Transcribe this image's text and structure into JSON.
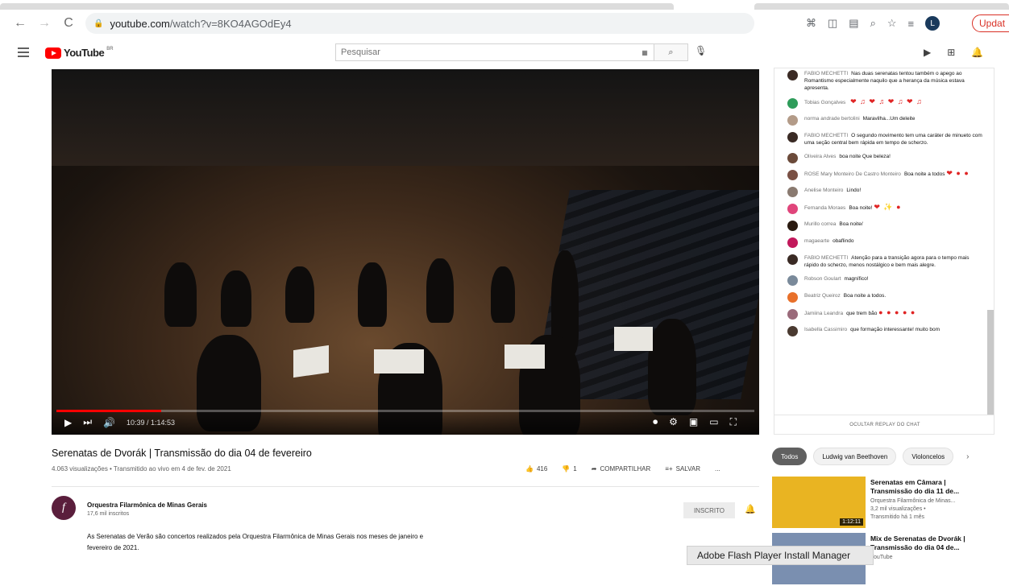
{
  "browser": {
    "url_host": "youtube.com",
    "url_path": "/watch?v=8KO4AGOdEy4",
    "profile_initial": "L",
    "update_label": "Updat"
  },
  "header": {
    "logo_text": "YouTube",
    "logo_suffix": "BR",
    "search_placeholder": "Pesquisar"
  },
  "player": {
    "time": "10:39 / 1:14:53",
    "progress": 0.15
  },
  "video": {
    "title": "Serenatas de Dvorák | Transmissão do dia 04 de fevereiro",
    "meta": "4.063 visualizações • Transmitido ao vivo em 4 de fev. de 2021",
    "likes": "416",
    "dislikes": "1",
    "share_label": "COMPARTILHAR",
    "save_label": "SALVAR",
    "more_label": "..."
  },
  "channel": {
    "name": "Orquestra Filarmônica de Minas Gerais",
    "subs": "17,6 mil inscritos",
    "subscribe_label": "INSCRITO",
    "avatar_letter": "f",
    "description": "As Serenatas de Verão são concertos realizados pela Orquestra Filarmônica de Minas Gerais nos meses de janeiro e fevereiro de 2021."
  },
  "chat": {
    "messages": [
      {
        "author": "FABIO MECHETTI",
        "text": "Nas duas serenatas tentou também o apego ao Romantismo especialmente naquilo que a herança da música estava apresenta.",
        "color": "#3a2a24"
      },
      {
        "author": "Tobias Gonçalves",
        "text": "",
        "emoji": "❤ ♫ ❤ ♫ ❤ ♫ ❤ ♫",
        "color": "#2e9c5a"
      },
      {
        "author": "norma andrade bertolini",
        "text": "Maravilha...Um deleite",
        "color": "#b39b88"
      },
      {
        "author": "FABIO MECHETTI",
        "text": "O segundo movimento tem uma caráter de minueto com uma seção central bem rápida em tempo de scherzo.",
        "color": "#3a2a24"
      },
      {
        "author": "Oliveira Alves",
        "text": "boa noite Que beleza!",
        "color": "#6b4a3a"
      },
      {
        "author": "ROSE Mary Monteiro De Castro Monteiro",
        "text": "Boa noite a todos",
        "emoji": "❤ ● ●",
        "color": "#7a5044"
      },
      {
        "author": "Anelise Monteiro",
        "text": "Lindo!",
        "color": "#8a7a70"
      },
      {
        "author": "Fernanda Moraes",
        "text": "Boa noite!",
        "emoji": "❤ ✨ ●",
        "color": "#e0457b"
      },
      {
        "author": "Murillo correa",
        "text": "Boa noite/",
        "color": "#2a1a10"
      },
      {
        "author": "magaearte",
        "text": "obaflindo",
        "color": "#c2185b"
      },
      {
        "author": "FABIO MECHETTI",
        "text": "Atenção para a transição agora para o tempo mais rápido do scherzo, menos nostálgico e bem mais alegre.",
        "color": "#3a2a24"
      },
      {
        "author": "Robson Goulart",
        "text": "magnífico!",
        "color": "#7a8a9a"
      },
      {
        "author": "Beatriz Queiroz",
        "text": "Boa noite a todos.",
        "color": "#e8702a"
      },
      {
        "author": "Jamiina Leandra",
        "text": "que trem bão",
        "emoji": "● ● ● ● ●",
        "color": "#9a6a7a"
      },
      {
        "author": "Isabella Cassimiro",
        "text": "que formação interessante! muito bom",
        "color": "#4a3a30"
      }
    ],
    "footer": "OCULTAR REPLAY DO CHAT"
  },
  "chips": {
    "items": [
      "Todos",
      "Ludwig van Beethoven",
      "Violoncelos"
    ],
    "next": "›"
  },
  "related": [
    {
      "title": "Serenatas em Câmara | Transmissão do dia 11 de...",
      "channel": "Orquestra Filarmônica de Minas...",
      "meta1": "3,2 mil visualizações •",
      "meta2": "Transmitido há 1 mês",
      "duration": "1:12:11",
      "thumb_color": "#e9b422"
    },
    {
      "title": "Mix de Serenatas de Dvorák | Transmissão do dia 04 de...",
      "channel": "YouTube",
      "meta1": "",
      "meta2": "",
      "duration": "",
      "thumb_color": "#7a8fb0"
    }
  ],
  "flash": {
    "label": "Adobe Flash Player Install Manager"
  }
}
